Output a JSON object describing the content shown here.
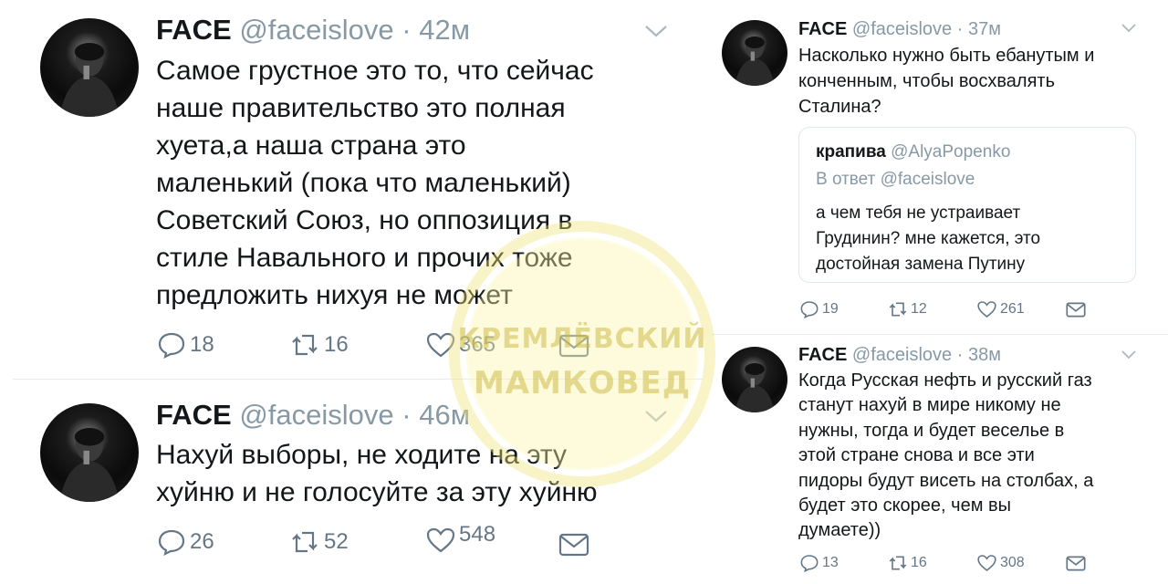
{
  "left_tweets": [
    {
      "name": "FACE",
      "handle": "@faceislove",
      "dot": "·",
      "time": "42м",
      "lines": [
        "Самое грустное это то, что сейчас",
        "наше правительство это полная",
        "хуета,а наша страна это",
        "маленький (пока что маленький)",
        "Советский Союз, но оппозиция в",
        "стиле Навального и прочих тоже",
        "предложить нихуя не может"
      ],
      "replies": "18",
      "retweets": "16",
      "likes": "365"
    },
    {
      "name": "FACE",
      "handle": "@faceislove",
      "dot": "·",
      "time": "46м",
      "lines": [
        "Нахуй выборы, не ходите на эту",
        "хуйню и не голосуйте за эту хуйню"
      ],
      "replies": "26",
      "retweets": "52",
      "likes": "548"
    }
  ],
  "right_tweets": [
    {
      "name": "FACE",
      "handle": "@faceislove",
      "dot": "·",
      "time": "37м",
      "lines": [
        "Насколько нужно быть ебанутым и",
        "конченным, чтобы восхвалять",
        "Сталина?"
      ],
      "quote": {
        "name": "крапива",
        "handle": "@AlyaPopenko",
        "reply_to": "В ответ @faceislove",
        "lines": [
          "а чем тебя не устраивает",
          "Грудинин? мне кажется, это",
          "достойная замена Путину"
        ]
      },
      "replies": "19",
      "retweets": "12",
      "likes": "261"
    },
    {
      "name": "FACE",
      "handle": "@faceislove",
      "dot": "·",
      "time": "38м",
      "lines": [
        "Когда Русская нефть и русский газ",
        "станут нахуй в мире никому не",
        "нужны, тогда и будет веселье в",
        "этой стране снова и все эти",
        "пидоры будут висеть на столбах, а",
        "будет это скорее, чем вы",
        "думаете))"
      ],
      "replies": "13",
      "retweets": "16",
      "likes": "308"
    }
  ],
  "watermark": {
    "line1": "КРЕМЛЁВСКИЙ",
    "line2": "МАМКОВЕД"
  },
  "colors": {
    "text": "#14171a",
    "muted": "#8899a6",
    "icon": "#657786",
    "divider": "#e6ecf0",
    "watermark": "#f0e478"
  },
  "icons": [
    "reply-icon",
    "retweet-icon",
    "like-icon",
    "message-icon",
    "chevron-down-icon"
  ]
}
